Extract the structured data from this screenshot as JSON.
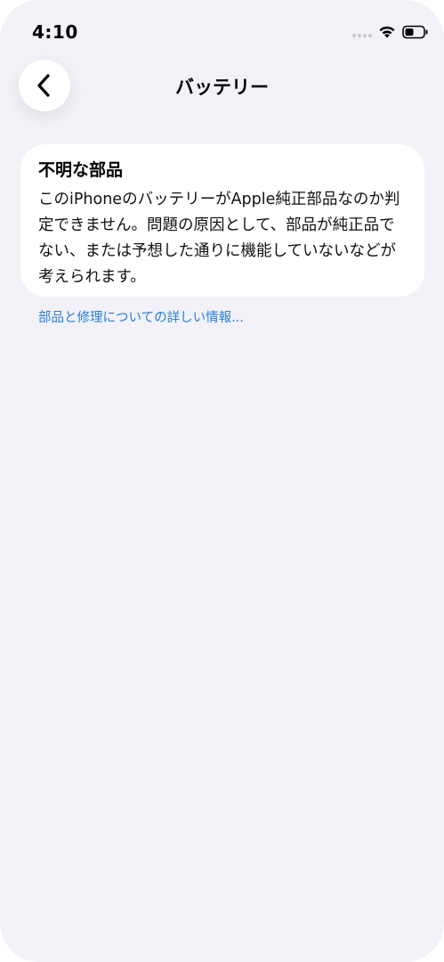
{
  "status_bar": {
    "time": "4:10",
    "icons": [
      "cellular-dots-icon",
      "wifi-icon",
      "battery-icon"
    ]
  },
  "navigation": {
    "back_icon": "chevron-left-icon",
    "title": "バッテリー"
  },
  "card": {
    "title": "不明な部品",
    "body": "このiPhoneのバッテリーがApple純正部品なのか判定できません。問題の原因として、部品が純正品でない、または予想した通りに機能していないなどが考えられます。"
  },
  "link": {
    "label": "部品と修理についての詳しい情報..."
  },
  "colors": {
    "background": "#f1f1f7",
    "card": "#ffffff",
    "link": "#2a7fd4"
  }
}
